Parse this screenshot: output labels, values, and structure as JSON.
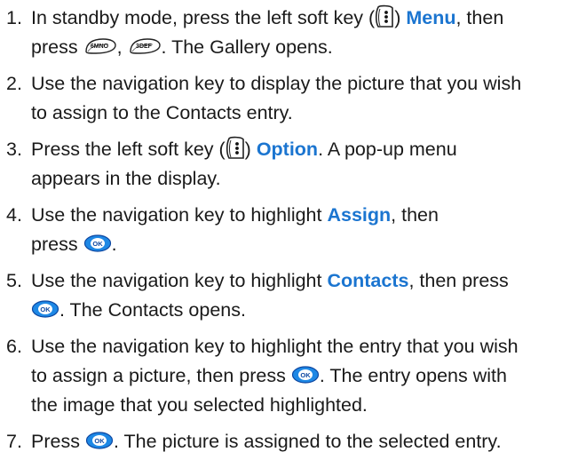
{
  "steps": [
    {
      "num": "1.",
      "t1": "In standby mode, press the left soft key (",
      "t2": ") ",
      "hl": "Menu",
      "t3": ", then",
      "t4": "press ",
      "t5": ", ",
      "t6": ". The Gallery opens.",
      "key_6": "6MNO",
      "key_3": "3DEF"
    },
    {
      "num": "2.",
      "t1": "Use the navigation key to display the picture that you wish",
      "t2": "to assign to the Contacts entry."
    },
    {
      "num": "3.",
      "t1": "Press the left soft key (",
      "t2": ") ",
      "hl": "Option",
      "t3": ". A pop-up menu",
      "t4": "appears in the display."
    },
    {
      "num": "4.",
      "t1": "Use the navigation key to highlight ",
      "hl": "Assign",
      "t2": ", then",
      "t3": "press ",
      "t4": "."
    },
    {
      "num": "5.",
      "t1": "Use the navigation key to highlight ",
      "hl": "Contacts",
      "t2": ", then press",
      "t3": ". The Contacts opens."
    },
    {
      "num": "6.",
      "t1": "Use the navigation key to highlight the entry that you wish",
      "t2": "to assign a picture, then press ",
      "t3": ". The entry opens with",
      "t4": "the image that you selected highlighted."
    },
    {
      "num": "7.",
      "t1": "Press ",
      "t2": ". The picture is assigned to the selected entry."
    }
  ],
  "ok_label": "OK",
  "icons": {
    "soft_key": "left-soft-key-icon",
    "ok": "ok-key-icon",
    "key_6": "key-6-icon",
    "key_3": "key-3-icon"
  },
  "colors": {
    "highlight": "#1b75d0",
    "ok_key": "#1e88e5",
    "text": "#1a1a1a"
  }
}
